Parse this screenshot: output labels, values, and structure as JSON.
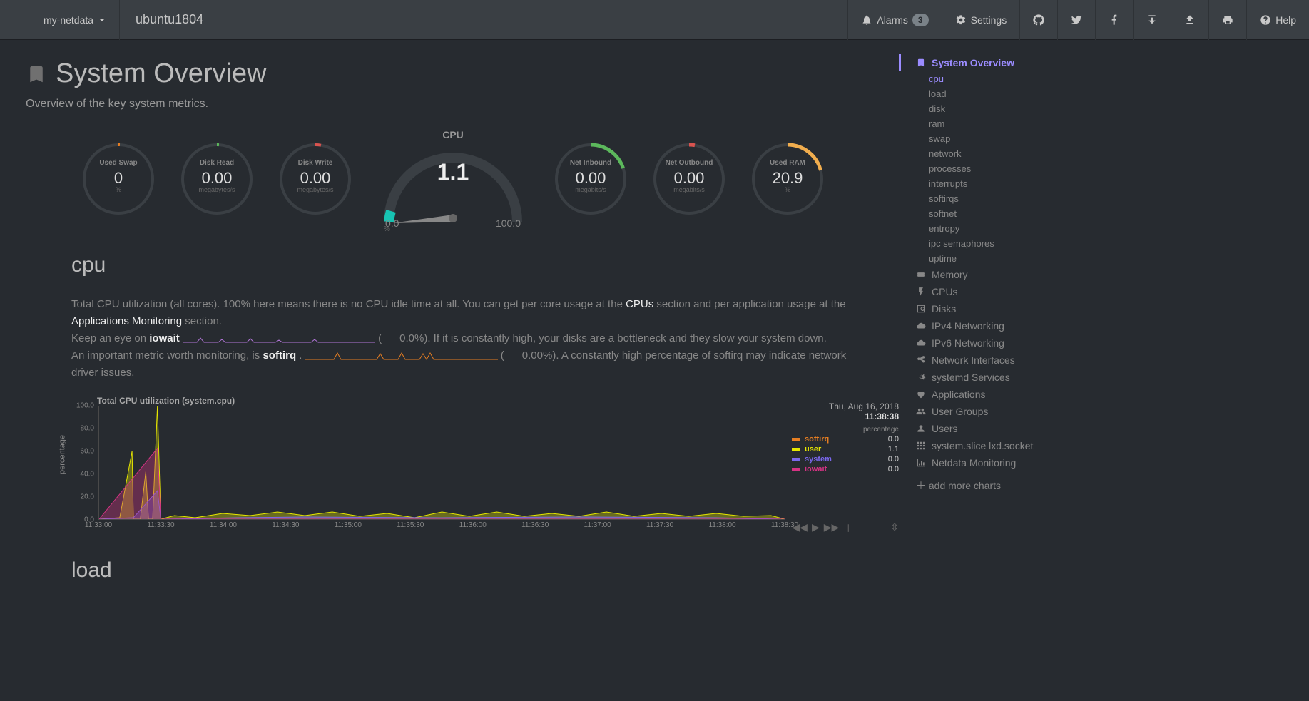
{
  "nav": {
    "brand": "my-netdata",
    "hostname": "ubuntu1804",
    "alarms_label": "Alarms",
    "alarms_count": "3",
    "settings_label": "Settings",
    "help_label": "Help"
  },
  "page": {
    "title": "System Overview",
    "subtitle": "Overview of the key system metrics."
  },
  "gauges": {
    "used_swap": {
      "label": "Used Swap",
      "value": "0",
      "unit": "%"
    },
    "disk_read": {
      "label": "Disk Read",
      "value": "0.00",
      "unit": "megabytes/s"
    },
    "disk_write": {
      "label": "Disk Write",
      "value": "0.00",
      "unit": "megabytes/s"
    },
    "cpu": {
      "label": "CPU",
      "value": "1.1",
      "min": "0.0",
      "max": "100.0",
      "unit": "%"
    },
    "net_in": {
      "label": "Net Inbound",
      "value": "0.00",
      "unit": "megabits/s"
    },
    "net_out": {
      "label": "Net Outbound",
      "value": "0.00",
      "unit": "megabits/s"
    },
    "used_ram": {
      "label": "Used RAM",
      "value": "20.9",
      "unit": "%"
    }
  },
  "cpu_section": {
    "heading": "cpu",
    "desc1_a": "Total CPU utilization (all cores). 100% here means there is no CPU idle time at all. You can get per core usage at the ",
    "link_cpus": "CPUs",
    "desc1_b": " section and per application usage at the ",
    "link_apps": "Applications Monitoring",
    "desc1_c": " section.",
    "desc2_a": "Keep an eye on ",
    "metric_iowait": "iowait",
    "iowait_pct": "0.0%",
    "desc2_b": "). If it is constantly high, your disks are a bottleneck and they slow your system down.",
    "desc3_a": "An important metric worth monitoring, is ",
    "metric_softirq": "softirq",
    "softirq_pct": "0.00%",
    "desc3_b": "). A constantly high percentage of softirq may indicate network driver issues."
  },
  "chart_data": {
    "type": "area",
    "title": "Total CPU utilization (system.cpu)",
    "ylabel": "percentage",
    "ylim": [
      0,
      100
    ],
    "yticks": [
      0,
      20,
      40,
      60,
      80,
      100
    ],
    "xticks": [
      "11:33:00",
      "11:33:30",
      "11:34:00",
      "11:34:30",
      "11:35:00",
      "11:35:30",
      "11:36:00",
      "11:36:30",
      "11:37:00",
      "11:37:30",
      "11:38:00",
      "11:38:30"
    ],
    "timestamp_date": "Thu, Aug 16, 2018",
    "timestamp_time": "11:38:38",
    "legend_header": "percentage",
    "series": [
      {
        "name": "softirq",
        "color": "#e67e22",
        "value": "0.0"
      },
      {
        "name": "user",
        "color": "#e6e600",
        "value": "1.1"
      },
      {
        "name": "system",
        "color": "#7b68ee",
        "value": "0.0"
      },
      {
        "name": "iowait",
        "color": "#d63384",
        "value": "0.0"
      }
    ],
    "approx_peaks": [
      {
        "x_pct": 5,
        "h": 60
      },
      {
        "x_pct": 7,
        "h": 42
      },
      {
        "x_pct": 8.5,
        "h": 100
      },
      {
        "x_pct": 12,
        "h": 8
      },
      {
        "x_pct": 30,
        "h": 10
      }
    ]
  },
  "load_section": {
    "heading": "load"
  },
  "sidebar": {
    "top": {
      "label": "System Overview"
    },
    "subs": [
      "cpu",
      "load",
      "disk",
      "ram",
      "swap",
      "network",
      "processes",
      "interrupts",
      "softirqs",
      "softnet",
      "entropy",
      "ipc semaphores",
      "uptime"
    ],
    "sections": [
      {
        "icon": "memory",
        "label": "Memory"
      },
      {
        "icon": "bolt",
        "label": "CPUs"
      },
      {
        "icon": "hdd",
        "label": "Disks"
      },
      {
        "icon": "cloud",
        "label": "IPv4 Networking"
      },
      {
        "icon": "cloud",
        "label": "IPv6 Networking"
      },
      {
        "icon": "share",
        "label": "Network Interfaces"
      },
      {
        "icon": "cogs",
        "label": "systemd Services"
      },
      {
        "icon": "heart",
        "label": "Applications"
      },
      {
        "icon": "users",
        "label": "User Groups"
      },
      {
        "icon": "user",
        "label": "Users"
      },
      {
        "icon": "th",
        "label": "system.slice lxd.socket"
      },
      {
        "icon": "chart",
        "label": "Netdata Monitoring"
      }
    ],
    "add_more": "add more charts"
  }
}
